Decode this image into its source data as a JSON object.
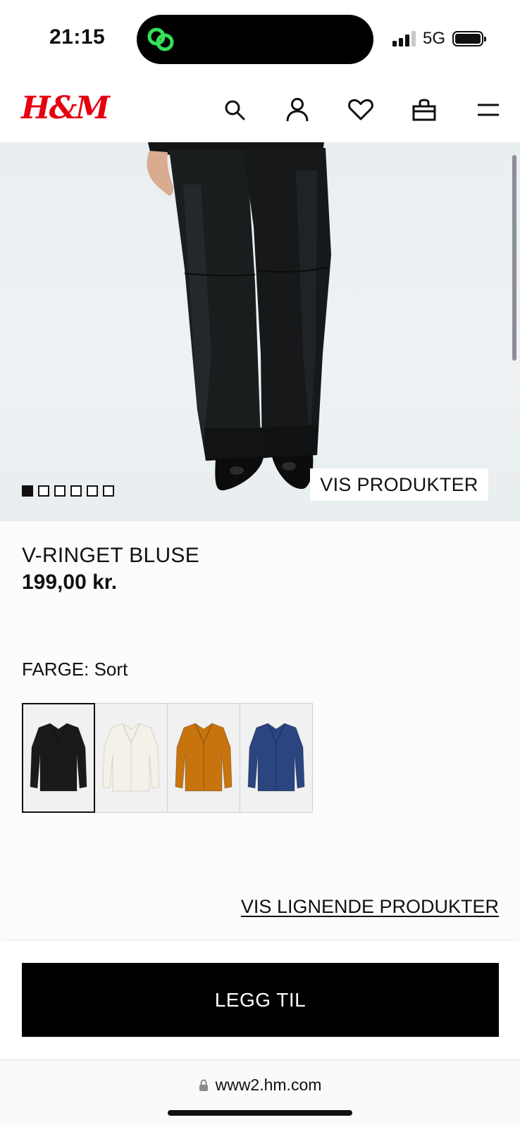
{
  "status_bar": {
    "time": "21:15",
    "network": "5G"
  },
  "header": {
    "logo": "H&M",
    "icons": [
      "search-icon",
      "account-icon",
      "heart-icon",
      "bag-icon",
      "menu-icon"
    ]
  },
  "gallery": {
    "image_count": 6,
    "active_index": 0,
    "show_products_label": "VIS PRODUKTER"
  },
  "product": {
    "name": "V-RINGET BLUSE",
    "price": "199,00 kr.",
    "color_label": "FARGE: Sort",
    "swatches": [
      {
        "color": "#1a1a1a",
        "selected": true
      },
      {
        "color": "#f4f1e8",
        "selected": false
      },
      {
        "color": "#c8740e",
        "selected": false
      },
      {
        "color": "#2a4580",
        "selected": false
      }
    ],
    "similar_link": "VIS LIGNENDE PRODUKTER"
  },
  "actions": {
    "add_label": "LEGG TIL"
  },
  "browser": {
    "url": "www2.hm.com"
  },
  "colors": {
    "brand": "#e50010",
    "island_accent": "#35e05a"
  }
}
